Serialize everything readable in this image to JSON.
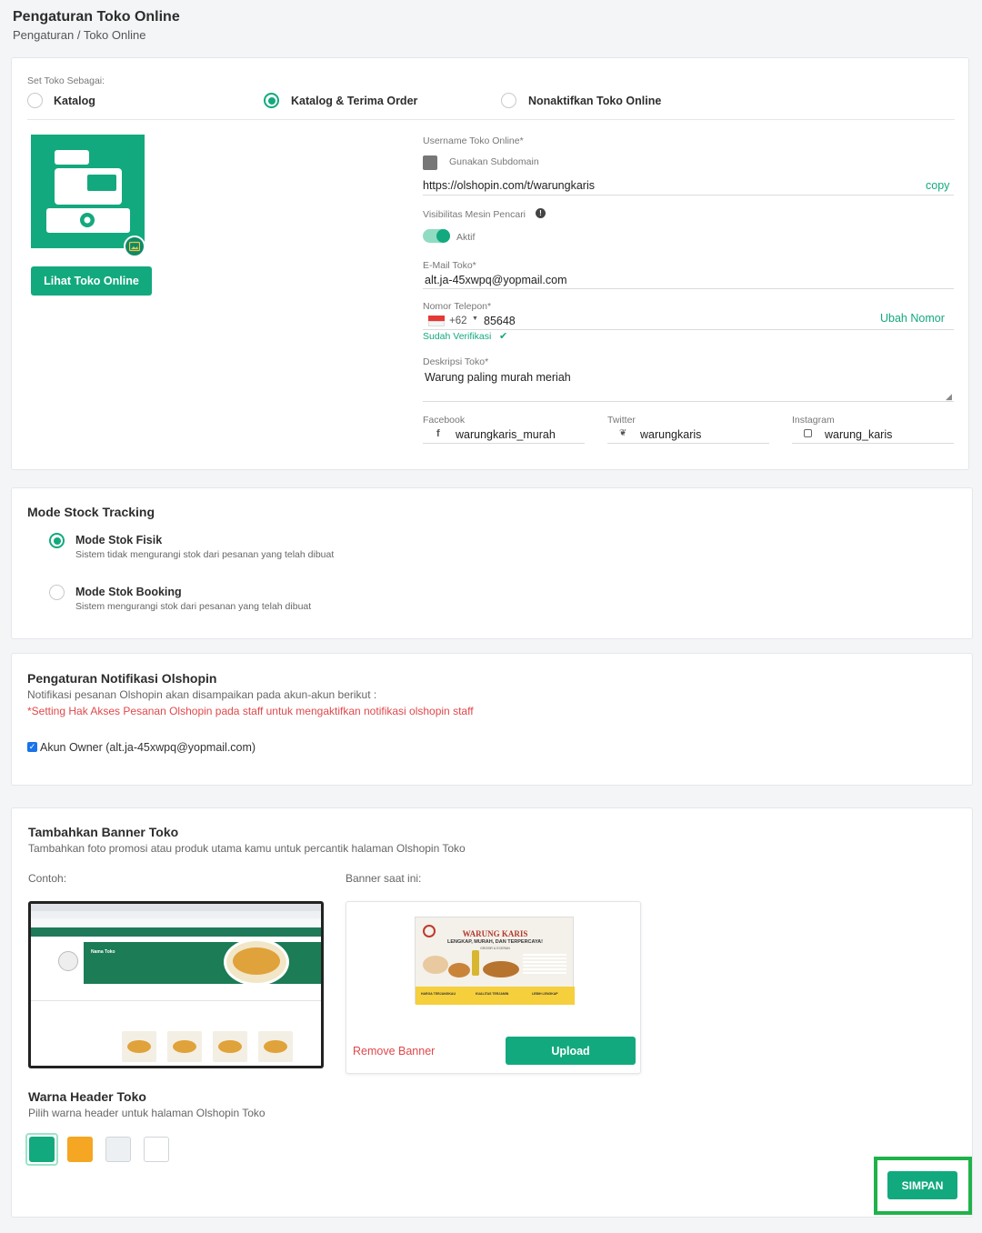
{
  "page": {
    "title": "Pengaturan Toko Online",
    "breadcrumb": "Pengaturan / Toko Online"
  },
  "store_mode": {
    "label": "Set Toko Sebagai:",
    "options": [
      {
        "label": "Katalog",
        "selected": false
      },
      {
        "label": "Katalog & Terima Order",
        "selected": true
      },
      {
        "label": "Nonaktifkan Toko Online",
        "selected": false
      }
    ]
  },
  "store_profile": {
    "view_button": "Lihat Toko Online",
    "username_label": "Username Toko Online*",
    "subdomain_label": "Gunakan Subdomain",
    "url": "https://olshopin.com/t/warungkaris",
    "copy_label": "copy",
    "visibility_label": "Visibilitas Mesin Pencari",
    "visibility_status": "Aktif",
    "email_label": "E-Mail Toko*",
    "email": "alt.ja-45xwpq@yopmail.com",
    "phone_label": "Nomor Telepon*",
    "country_code": "+62",
    "phone": "85648",
    "change_phone": "Ubah Nomor",
    "verified": "Sudah Verifikasi",
    "description_label": "Deskripsi Toko*",
    "description": "Warung paling murah meriah",
    "facebook_label": "Facebook",
    "facebook": "warungkaris_murah",
    "twitter_label": "Twitter",
    "twitter": "warungkaris",
    "instagram_label": "Instagram",
    "instagram": "warung_karis"
  },
  "stock_tracking": {
    "title": "Mode Stock Tracking",
    "options": [
      {
        "label": "Mode Stok Fisik",
        "desc": "Sistem tidak mengurangi stok dari pesanan yang telah dibuat",
        "selected": true
      },
      {
        "label": "Mode Stok Booking",
        "desc": "Sistem mengurangi stok dari pesanan yang telah dibuat",
        "selected": false
      }
    ]
  },
  "notifications": {
    "title": "Pengaturan Notifikasi Olshopin",
    "desc": "Notifikasi pesanan Olshopin akan disampaikan pada akun-akun berikut :",
    "warning": "*Setting Hak Akses Pesanan Olshopin pada staff untuk mengaktifkan notifikasi olshopin staff",
    "owner_account": "Akun Owner (alt.ja-45xwpq@yopmail.com)"
  },
  "banner": {
    "title": "Tambahkan Banner Toko",
    "desc": "Tambahkan foto promosi atau produk utama kamu untuk percantik halaman Olshopin Toko",
    "example_label": "Contoh:",
    "current_label": "Banner saat ini:",
    "example_store_name": "Nama Toko",
    "banner_name": "WARUNG KARIS",
    "banner_tagline": "LENGKAP, MURAH, DAN TERPERCAYA!",
    "banner_sub": "GROSIR & ECERAN",
    "banner_badges": [
      "HARGA TERJANGKAU",
      "KUALITAS TERJAMIN",
      "LEBIH LENGKAP"
    ],
    "remove_label": "Remove Banner",
    "upload_label": "Upload"
  },
  "header_color": {
    "title": "Warna Header Toko",
    "desc": "Pilih warna header untuk halaman Olshopin Toko",
    "swatches": [
      "#13a97e",
      "#f5a623",
      "#edf0f3",
      "#ffffff"
    ]
  },
  "save_label": "SIMPAN",
  "colors": {
    "accent": "#13a97e",
    "danger": "#e0484b",
    "highlight_border": "#1fb24a"
  }
}
